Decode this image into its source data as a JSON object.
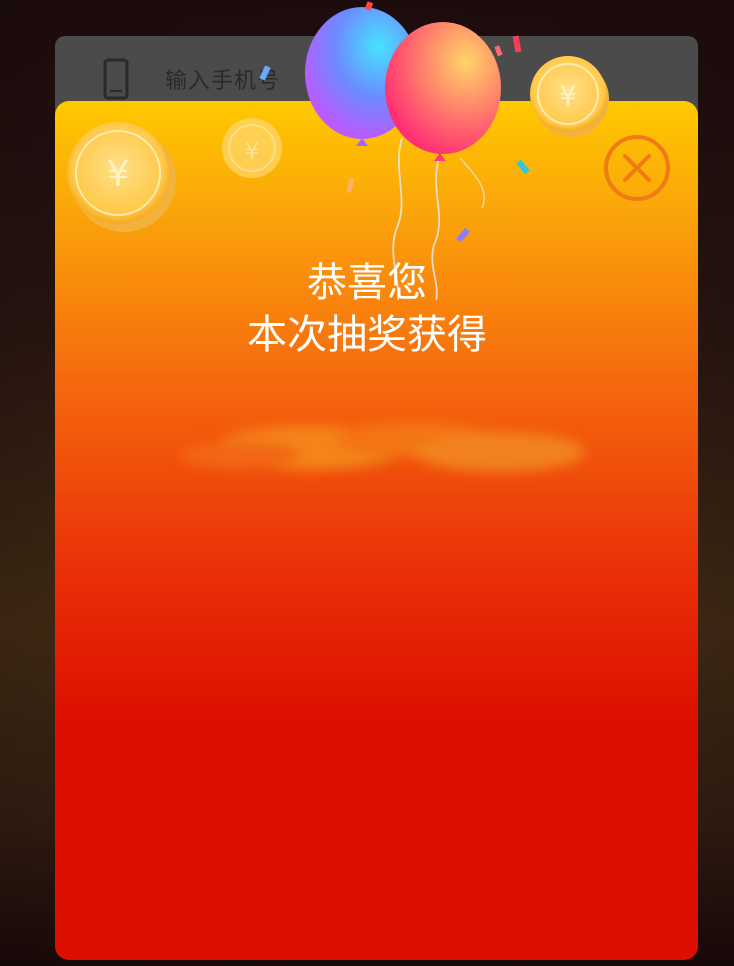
{
  "phone_field": {
    "placeholder": "输入手机号"
  },
  "popup": {
    "title_line1": "恭喜您",
    "title_line2": "本次抽奖获得",
    "coin_symbol": "¥"
  },
  "colors": {
    "popup_top": "#ffc900",
    "popup_bottom": "#dd0f00",
    "close_accent": "#f07a14",
    "balloon_blue": "#5aa7ff",
    "balloon_pink": "#ff4f7a"
  },
  "icons": {
    "phone": "phone-icon",
    "close": "close-icon",
    "coin": "yuan-coin-icon",
    "balloon": "balloon-icon"
  }
}
